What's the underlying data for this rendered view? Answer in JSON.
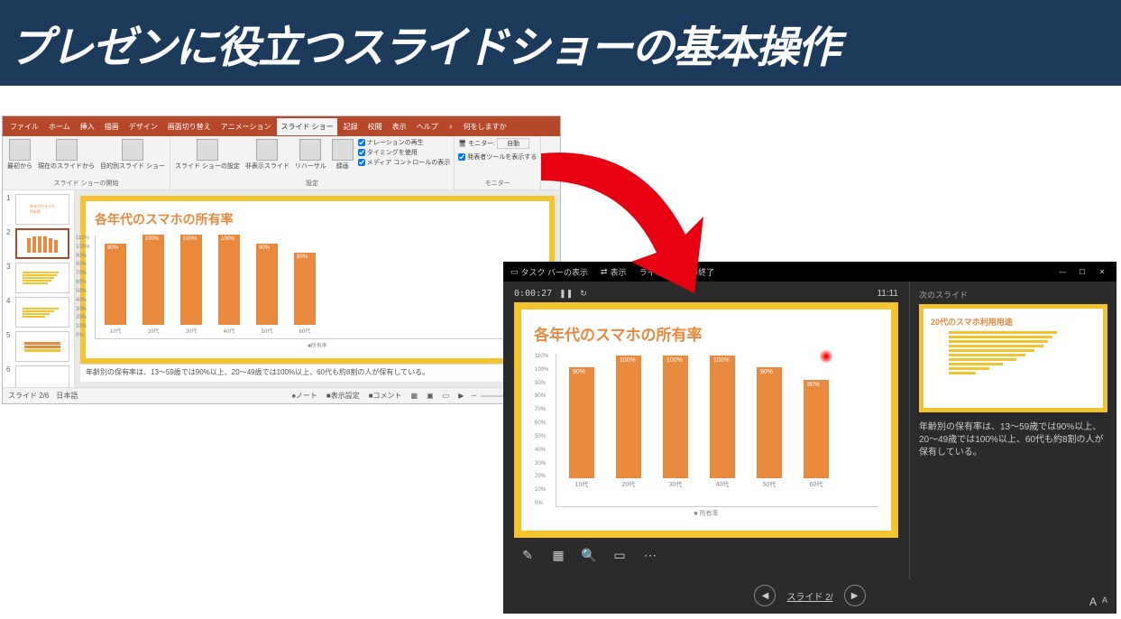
{
  "banner": {
    "title": "プレゼンに役立つスライドショーの基本操作"
  },
  "ppt": {
    "tabs": {
      "file": "ファイル",
      "home": "ホーム",
      "insert": "挿入",
      "draw": "描画",
      "design": "デザイン",
      "transitions": "画面切り替え",
      "animations": "アニメーション",
      "slideshow": "スライド ショー",
      "record": "記録",
      "review": "校閲",
      "view": "表示",
      "help": "ヘルプ",
      "tell_icon": "♀",
      "tell": "何をしますか"
    },
    "ribbon": {
      "from_beginning": "最初から",
      "from_current": "現在のスライドから",
      "custom": "目的別スライド ショー",
      "setup": "スライド ショーの設定",
      "hide": "非表示スライド",
      "rehearse": "リハーサル",
      "record": "録画",
      "narration": "ナレーションの再生",
      "timings": "タイミングを使用",
      "media": "メディア コントロールの表示",
      "monitor_label": "モニター:",
      "monitor_value": "自動",
      "presenter_tool": "発表者ツールを表示する",
      "group_start": "スライド ショーの開始",
      "group_setup": "設定",
      "group_monitor": "モニター"
    },
    "slide": {
      "title": "各年代のスマホの所有率",
      "legend": "■所有率"
    },
    "notes": "年齢別の保有率は、13～59歳では90%以上、20～49歳では100%以上、60代も約8割の人が保有している。",
    "status": {
      "counter": "スライド 2/6",
      "lang": "日本語",
      "notes_btn": "♠ノート",
      "display_btn": "■表示設定",
      "comment_btn": "■コメント",
      "zoom_minus": "－",
      "zoom_plus": "＋"
    }
  },
  "presenter": {
    "top": {
      "taskbar": "タスク バーの表示",
      "display": "表示",
      "end": "ライド ショーの終了"
    },
    "timer": "0:00:27",
    "clock": "11:11",
    "slide": {
      "title": "各年代のスマホの所有率",
      "legend": "■ 所有率"
    },
    "next_label": "次のスライド",
    "next_slide_title": "20代のスマホ利用用途",
    "notes": "年齢別の保有率は、13～59歳では90%以上、20～49歳では100%以上、60代も約8割の人が保有している。",
    "counter": "スライド 2/",
    "font_large": "A",
    "font_small": "A"
  },
  "chart_data": {
    "type": "bar",
    "title": "各年代のスマホの所有率",
    "categories": [
      "10代",
      "20代",
      "30代",
      "40代",
      "50代",
      "60代"
    ],
    "values": [
      90,
      100,
      100,
      100,
      90,
      80
    ],
    "bar_labels": [
      "90%",
      "100%",
      "100%",
      "100%",
      "90%",
      "80%"
    ],
    "xlabel": "",
    "ylabel": "",
    "ylim": [
      0,
      110
    ],
    "y_ticks": [
      "110%",
      "100%",
      "90%",
      "80%",
      "70%",
      "60%",
      "50%",
      "40%",
      "30%",
      "20%",
      "10%",
      "0%"
    ],
    "legend": "所有率"
  }
}
